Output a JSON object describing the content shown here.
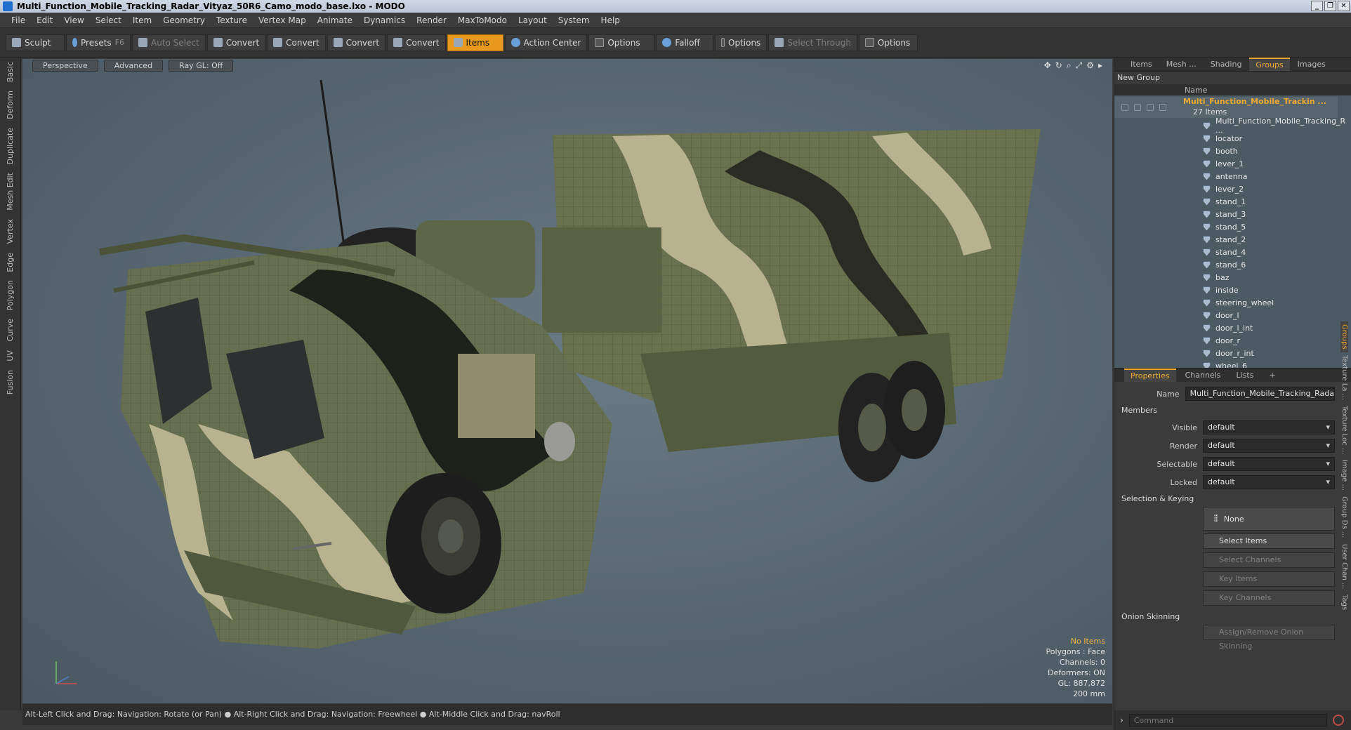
{
  "window": {
    "title": "Multi_Function_Mobile_Tracking_Radar_Vityaz_50R6_Camo_modo_base.lxo - MODO",
    "buttons": [
      "_",
      "❐",
      "✕"
    ]
  },
  "menu": [
    "File",
    "Edit",
    "View",
    "Select",
    "Item",
    "Geometry",
    "Texture",
    "Vertex Map",
    "Animate",
    "Dynamics",
    "Render",
    "MaxToModo",
    "Layout",
    "System",
    "Help"
  ],
  "toolbar": {
    "sculpt": "Sculpt",
    "presets": "Presets",
    "presets_key": "F6",
    "auto_select": "Auto Select",
    "convert1": "Convert",
    "convert2": "Convert",
    "convert3": "Convert",
    "convert4": "Convert",
    "items": "Items",
    "action_center": "Action Center",
    "options1": "Options",
    "falloff": "Falloff",
    "options2": "Options",
    "select_through": "Select Through",
    "options3": "Options"
  },
  "left_tabs": [
    "Basic",
    "Deform",
    "Duplicate",
    "Mesh Edit",
    "Vertex",
    "Edge",
    "Polygon",
    "Curve",
    "UV",
    "Fusion"
  ],
  "viewport": {
    "perspective": "Perspective",
    "advanced": "Advanced",
    "raygl": "Ray GL: Off",
    "hud": {
      "no_items": "No Items",
      "polygons": "Polygons : Face",
      "channels": "Channels: 0",
      "deformers": "Deformers: ON",
      "gl": "GL: 887,872",
      "scale": "200 mm"
    }
  },
  "status": "Alt-Left Click and Drag: Navigation: Rotate (or Pan) ● Alt-Right Click and Drag: Navigation: Freewheel ● Alt-Middle Click and Drag: navRoll",
  "right_tabs": [
    "Items",
    "Mesh ...",
    "Shading",
    "Groups",
    "Images"
  ],
  "right_tabs_selected": "Groups",
  "groups": {
    "new_group": "New Group",
    "col_name": "Name",
    "root_name": "Multi_Function_Mobile_Trackin ...",
    "root_count": "27 Items",
    "items": [
      "Multi_Function_Mobile_Tracking_R ...",
      "locator",
      "booth",
      "lever_1",
      "antenna",
      "lever_2",
      "stand_1",
      "stand_3",
      "stand_5",
      "stand_2",
      "stand_4",
      "stand_6",
      "baz",
      "inside",
      "steering_wheel",
      "door_l",
      "door_l_int",
      "door_r",
      "door_r_int",
      "wheel_6"
    ]
  },
  "prop_tabs": [
    "Properties",
    "Channels",
    "Lists",
    "+"
  ],
  "properties": {
    "name_label": "Name",
    "name_value": "Multi_Function_Mobile_Tracking_Rada",
    "members": "Members",
    "visible_label": "Visible",
    "visible_value": "default",
    "render_label": "Render",
    "render_value": "default",
    "selectable_label": "Selectable",
    "selectable_value": "default",
    "locked_label": "Locked",
    "locked_value": "default",
    "selection_keying": "Selection & Keying",
    "none": "None",
    "select_items": "Select Items",
    "select_channels": "Select Channels",
    "key_items": "Key Items",
    "key_channels": "Key Channels",
    "onion": "Onion Skinning",
    "assign_onion": "Assign/Remove Onion Skinning"
  },
  "side_vtabs": [
    "Groups",
    "Texture La ...",
    "Texture Loc ...",
    "Image ...",
    "Group Ds ...",
    "User Chan ...",
    "Tags"
  ],
  "command_placeholder": "Command",
  "colors": {
    "accent": "#e79a1d",
    "selected_text": "#f0a930"
  }
}
